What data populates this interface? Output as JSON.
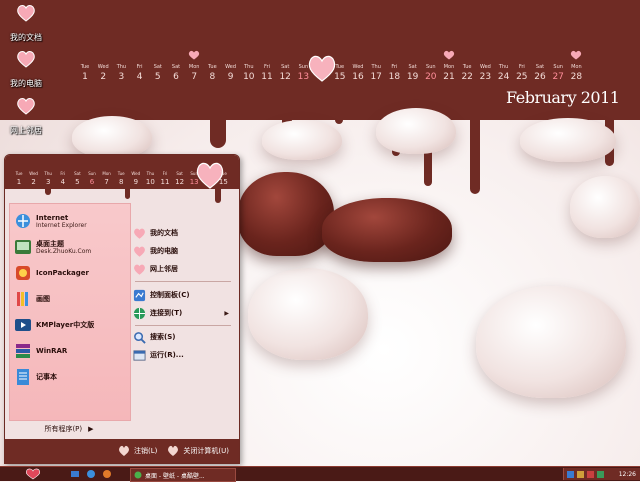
{
  "desktop": {
    "icons": [
      {
        "label": "我的文档"
      },
      {
        "label": "我的电脑"
      },
      {
        "label": "网上邻居"
      }
    ]
  },
  "calendar": {
    "month_label": "February 2011",
    "days": [
      {
        "dn": "Tue",
        "d": "1"
      },
      {
        "dn": "Wed",
        "d": "2"
      },
      {
        "dn": "Thu",
        "d": "3"
      },
      {
        "dn": "Fri",
        "d": "4"
      },
      {
        "dn": "Sat",
        "d": "5"
      },
      {
        "dn": "Sat",
        "d": "6"
      },
      {
        "dn": "Mon",
        "d": "7"
      },
      {
        "dn": "Tue",
        "d": "8"
      },
      {
        "dn": "Wed",
        "d": "9"
      },
      {
        "dn": "Thu",
        "d": "10"
      },
      {
        "dn": "Fri",
        "d": "11"
      },
      {
        "dn": "Sat",
        "d": "12"
      },
      {
        "dn": "Sun",
        "d": "13"
      },
      {
        "dn": "Mon",
        "d": "14"
      },
      {
        "dn": "Tue",
        "d": "15"
      },
      {
        "dn": "Wed",
        "d": "16"
      },
      {
        "dn": "Thu",
        "d": "17"
      },
      {
        "dn": "Fri",
        "d": "18"
      },
      {
        "dn": "Sat",
        "d": "19"
      },
      {
        "dn": "Sun",
        "d": "20"
      },
      {
        "dn": "Mon",
        "d": "21"
      },
      {
        "dn": "Tue",
        "d": "22"
      },
      {
        "dn": "Wed",
        "d": "23"
      },
      {
        "dn": "Thu",
        "d": "24"
      },
      {
        "dn": "Fri",
        "d": "25"
      },
      {
        "dn": "Sat",
        "d": "26"
      },
      {
        "dn": "Sun",
        "d": "27"
      },
      {
        "dn": "Mon",
        "d": "28"
      }
    ]
  },
  "start_menu": {
    "calendar_days": [
      {
        "dn": "Tue",
        "d": "1"
      },
      {
        "dn": "Wed",
        "d": "2"
      },
      {
        "dn": "Thu",
        "d": "3"
      },
      {
        "dn": "Fri",
        "d": "4"
      },
      {
        "dn": "Sat",
        "d": "5"
      },
      {
        "dn": "Sun",
        "d": "6"
      },
      {
        "dn": "Mon",
        "d": "7"
      },
      {
        "dn": "Tue",
        "d": "8"
      },
      {
        "dn": "Wed",
        "d": "9"
      },
      {
        "dn": "Thu",
        "d": "10"
      },
      {
        "dn": "Fri",
        "d": "11"
      },
      {
        "dn": "Sat",
        "d": "12"
      },
      {
        "dn": "Sun",
        "d": "13"
      },
      {
        "dn": "Mon",
        "d": "14"
      },
      {
        "dn": "Tue",
        "d": "15"
      }
    ],
    "left_items": [
      {
        "title": "Internet",
        "subtitle": "Internet Explorer"
      },
      {
        "title": "桌面主题",
        "subtitle": "Desk.ZhuoKu.Com"
      },
      {
        "title": "IconPackager",
        "subtitle": ""
      },
      {
        "title": "画图",
        "subtitle": ""
      },
      {
        "title": "KMPlayer中文版",
        "subtitle": ""
      },
      {
        "title": "WinRAR",
        "subtitle": ""
      },
      {
        "title": "记事本",
        "subtitle": ""
      }
    ],
    "right_items": [
      {
        "label": "我的文档"
      },
      {
        "label": "我的电脑"
      },
      {
        "label": "网上邻居"
      },
      {
        "label": "控制面板(C)"
      },
      {
        "label": "连接到(T)"
      },
      {
        "label": "搜索(S)"
      },
      {
        "label": "运行(R)..."
      }
    ],
    "all_programs": "所有程序(P)",
    "logoff": "注销(L)",
    "shutdown": "关闭计算机(U)"
  },
  "taskbar": {
    "task_title": "桌面 - 壁纸 - 桌酷壁...",
    "clock": "12:26"
  },
  "colors": {
    "chocolate": "#6f2b24",
    "pink": "#f5b7ba",
    "sunday_red": "#ff8e9a"
  }
}
